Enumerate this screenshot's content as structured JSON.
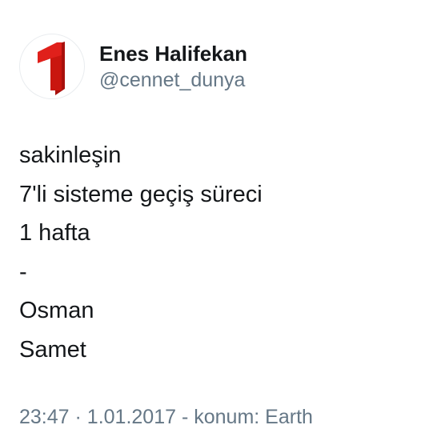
{
  "author": {
    "name": "Enes Halifekan",
    "handle": "@cennet_dunya",
    "avatar": {
      "icon": "number-one-logo-icon",
      "glyph": "1",
      "accent_color": "#e0201b",
      "shadow_color": "#a8100c"
    }
  },
  "tweet": {
    "lines": [
      "sakinleşin",
      "7'li sisteme geçiş süreci",
      "1 hafta",
      "-",
      "Osman",
      "Samet"
    ]
  },
  "meta": {
    "time": "23:47",
    "date": "1.01.2017",
    "location_label": "konum: Earth",
    "separator": "·",
    "dash": "-"
  },
  "colors": {
    "text_primary": "#14171a",
    "text_secondary": "#657786",
    "background": "#ffffff"
  }
}
